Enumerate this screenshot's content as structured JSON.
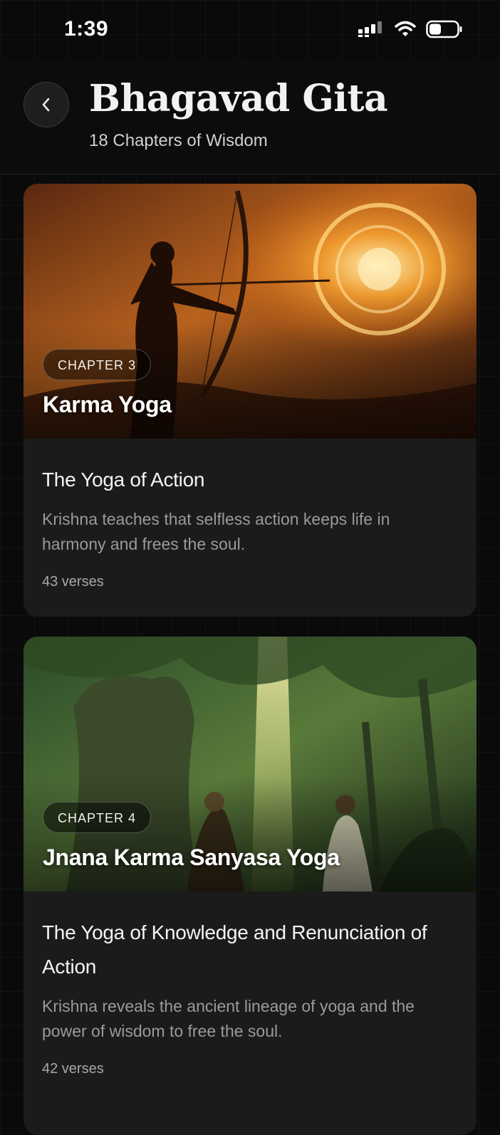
{
  "status_bar": {
    "time": "1:39"
  },
  "header": {
    "title": "Bhagavad Gita",
    "subtitle": "18 Chapters of Wisdom"
  },
  "chapters": [
    {
      "badge": "CHAPTER 3",
      "name": "Karma Yoga",
      "title": "The Yoga of Action",
      "description": "Krishna teaches that selfless action keeps life in harmony and frees the soul.",
      "verses": "43 verses"
    },
    {
      "badge": "CHAPTER 4",
      "name": "Jnana Karma Sanyasa Yoga",
      "title": "The Yoga of Knowledge and Renunciation of Action",
      "description": "Krishna reveals the ancient lineage of yoga and the power of wisdom to free the soul.",
      "verses": "42 verses"
    }
  ],
  "icons": {
    "back": "chevron-left-icon",
    "signal": "cellular-signal-icon",
    "wifi": "wifi-icon",
    "battery": "battery-icon"
  },
  "colors": {
    "background": "#0a0a0a",
    "card": "#1b1b1b",
    "description_text": "#9a9a9a"
  }
}
